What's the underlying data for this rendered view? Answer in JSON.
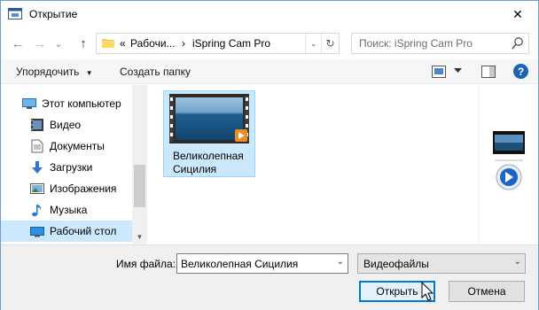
{
  "window": {
    "title": "Открытие",
    "close_glyph": "✕"
  },
  "nav": {
    "back": "←",
    "forward": "→",
    "dropdown": "⌄",
    "up": "↑",
    "address": {
      "overflow": "«",
      "crumbs": [
        "Рабочи...",
        "iSpring Cam Pro"
      ],
      "separator": "›",
      "refresh": "↻",
      "dropdown": "⌄"
    },
    "search": {
      "placeholder": "Поиск: iSpring Cam Pro"
    }
  },
  "toolbar": {
    "organize": "Упорядочить",
    "organize_arrow": "▼",
    "new_folder": "Создать папку",
    "help": "?"
  },
  "sidebar": {
    "items": [
      {
        "label": "Этот компьютер",
        "icon": "computer-icon"
      },
      {
        "label": "Видео",
        "icon": "video-folder-icon"
      },
      {
        "label": "Документы",
        "icon": "documents-icon"
      },
      {
        "label": "Загрузки",
        "icon": "downloads-icon"
      },
      {
        "label": "Изображения",
        "icon": "pictures-icon"
      },
      {
        "label": "Музыка",
        "icon": "music-icon"
      },
      {
        "label": "Рабочий стол",
        "icon": "desktop-icon"
      }
    ],
    "scroll_down": "▼"
  },
  "files": [
    {
      "name_line1": "Великолепная",
      "name_line2": "Сицилия",
      "type": "video",
      "selected": true
    }
  ],
  "bottom": {
    "filename_label": "Имя файла:",
    "filename_value": "Великолепная Сицилия",
    "filetype_value": "Видеофайлы",
    "combo_arrow": "⌄",
    "open_button": "Открыть",
    "cancel_button": "Отмена"
  },
  "colors": {
    "accent": "#0078d7",
    "selection": "#cce8ff",
    "toolbar": "#f5f6f7",
    "footer": "#f0f0f0"
  }
}
